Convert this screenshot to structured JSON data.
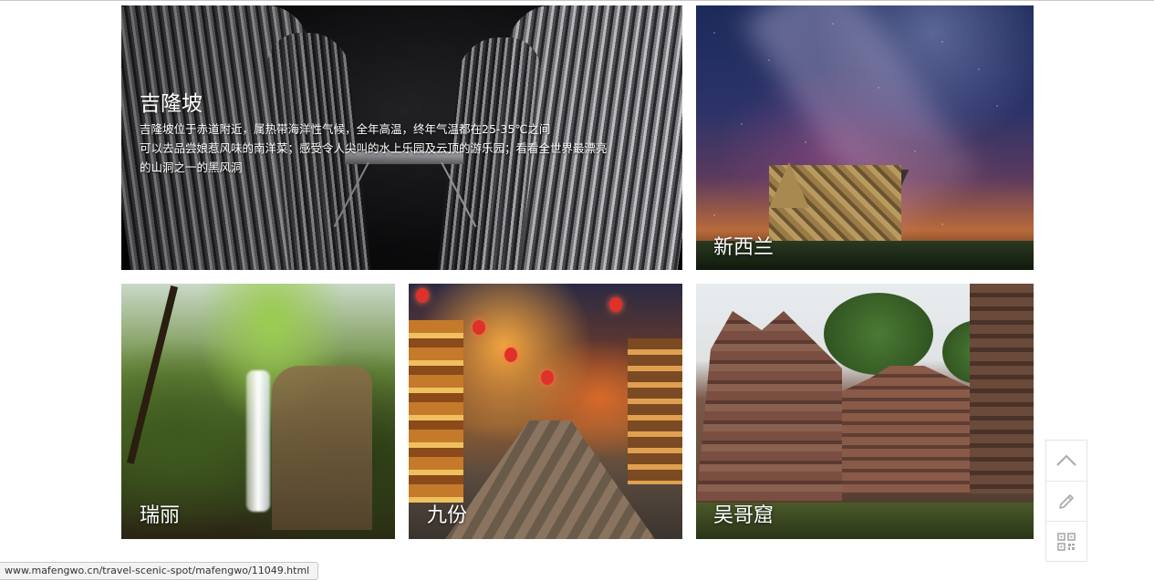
{
  "cards": [
    {
      "title": "吉隆坡",
      "desc_lines": [
        "吉隆坡位于赤道附近，属热带海洋性气候，全年高温，终年气温都在25-35℃之间",
        "可以去品尝娘惹风味的南洋菜；感受令人尖叫的水上乐园及云顶的游乐园；看看全世界最漂亮",
        "的山洞之一的黑风洞"
      ]
    },
    {
      "title": "新西兰"
    },
    {
      "title": "瑞丽"
    },
    {
      "title": "九份"
    },
    {
      "title": "吴哥窟"
    }
  ],
  "toolbar": {
    "items": [
      {
        "icon": "chevron-up-icon"
      },
      {
        "icon": "pencil-icon"
      },
      {
        "icon": "qr-code-icon"
      }
    ]
  },
  "status_bar": {
    "url": "www.mafengwo.cn/travel-scenic-spot/mafengwo/11049.html"
  }
}
